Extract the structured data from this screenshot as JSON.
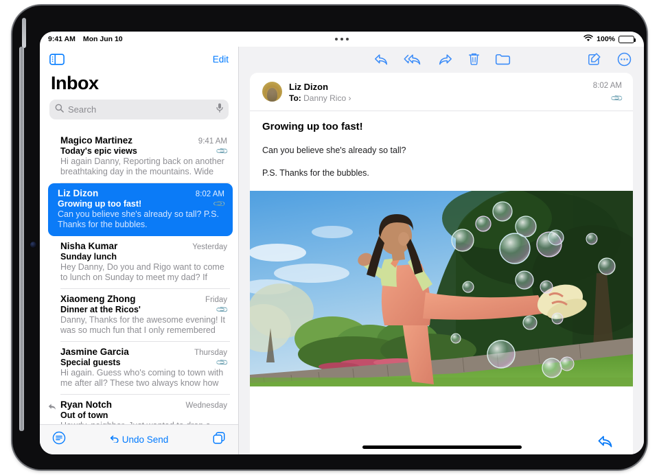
{
  "status_bar": {
    "time": "9:41 AM",
    "date": "Mon Jun 10",
    "battery_percent": "100%",
    "wifi_icon": "wifi-icon",
    "battery_icon": "battery-icon",
    "multitask_icon": "multitasking-dots-icon"
  },
  "sidebar": {
    "toggle_icon": "sidebar-toggle-icon",
    "edit_label": "Edit",
    "title": "Inbox",
    "search": {
      "placeholder": "Search",
      "search_icon": "search-icon",
      "mic_icon": "microphone-icon"
    },
    "messages": [
      {
        "sender": "Magico Martinez",
        "time": "9:41 AM",
        "subject": "Today's epic views",
        "preview": "Hi again Danny, Reporting back on another breathtaking day in the mountains. Wide o…",
        "has_attachment": true,
        "replied": false,
        "selected": false
      },
      {
        "sender": "Liz Dizon",
        "time": "8:02 AM",
        "subject": "Growing up too fast!",
        "preview": "Can you believe she's already so tall? P.S. Thanks for the bubbles.",
        "has_attachment": true,
        "replied": false,
        "selected": true
      },
      {
        "sender": "Nisha Kumar",
        "time": "Yesterday",
        "subject": "Sunday lunch",
        "preview": "Hey Danny, Do you and Rigo want to come to lunch on Sunday to meet my dad? If you…",
        "has_attachment": false,
        "replied": false,
        "selected": false
      },
      {
        "sender": "Xiaomeng Zhong",
        "time": "Friday",
        "subject": "Dinner at the Ricos'",
        "preview": "Danny, Thanks for the awesome evening! It was so much fun that I only remembered t…",
        "has_attachment": true,
        "replied": false,
        "selected": false
      },
      {
        "sender": "Jasmine Garcia",
        "time": "Thursday",
        "subject": "Special guests",
        "preview": "Hi again. Guess who's coming to town with me after all? These two always know how t…",
        "has_attachment": true,
        "replied": false,
        "selected": false
      },
      {
        "sender": "Ryan Notch",
        "time": "Wednesday",
        "subject": "Out of town",
        "preview": "Howdy, neighbor, Just wanted to drop a quick note to let you know we're leaving T…",
        "has_attachment": false,
        "replied": true,
        "selected": false
      }
    ],
    "bottom_bar": {
      "filter_icon": "filter-list-icon",
      "undo_send_label": "Undo Send",
      "undo_icon": "undo-arrow-icon",
      "new_window_icon": "copy-windows-icon"
    }
  },
  "detail": {
    "toolbar": {
      "reply_icon": "reply-icon",
      "reply_all_icon": "reply-all-icon",
      "forward_icon": "forward-icon",
      "trash_icon": "trash-icon",
      "folder_icon": "folder-icon",
      "compose_icon": "compose-icon",
      "more_icon": "more-circle-icon"
    },
    "message": {
      "avatar": "sender-avatar",
      "from_name": "Liz Dizon",
      "to_label": "To:",
      "to_name": "Danny Rico",
      "to_chevron": "chevron-right-icon",
      "time": "8:02 AM",
      "attachment_icon": "paperclip-icon",
      "subject": "Growing up too fast!",
      "paragraph_1": "Can you believe she's already so tall?",
      "paragraph_2": "P.S. Thanks for the bubbles.",
      "photo_alt": "girl-kicking-with-bubbles-photo"
    },
    "footer": {
      "reply_icon": "reply-icon"
    }
  },
  "colors": {
    "accent": "#007aff",
    "selected_row": "#0b7bf7",
    "secondary_text": "#8e8e93"
  }
}
